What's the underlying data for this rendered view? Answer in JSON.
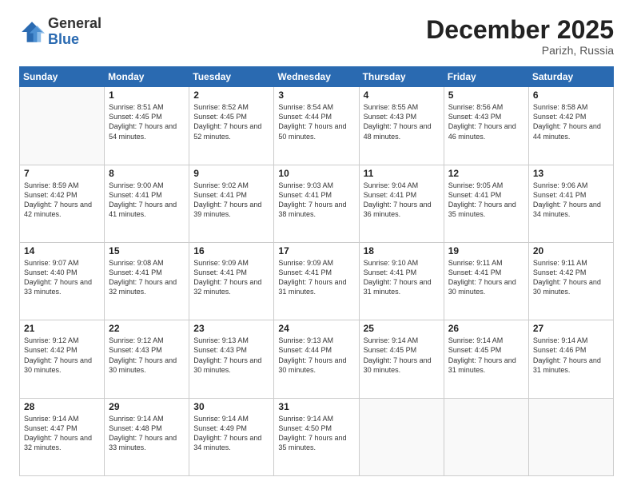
{
  "logo": {
    "general": "General",
    "blue": "Blue"
  },
  "header": {
    "month": "December 2025",
    "location": "Parizh, Russia"
  },
  "days_of_week": [
    "Sunday",
    "Monday",
    "Tuesday",
    "Wednesday",
    "Thursday",
    "Friday",
    "Saturday"
  ],
  "weeks": [
    [
      {
        "day": "",
        "sunrise": "",
        "sunset": "",
        "daylight": ""
      },
      {
        "day": "1",
        "sunrise": "Sunrise: 8:51 AM",
        "sunset": "Sunset: 4:45 PM",
        "daylight": "Daylight: 7 hours and 54 minutes."
      },
      {
        "day": "2",
        "sunrise": "Sunrise: 8:52 AM",
        "sunset": "Sunset: 4:45 PM",
        "daylight": "Daylight: 7 hours and 52 minutes."
      },
      {
        "day": "3",
        "sunrise": "Sunrise: 8:54 AM",
        "sunset": "Sunset: 4:44 PM",
        "daylight": "Daylight: 7 hours and 50 minutes."
      },
      {
        "day": "4",
        "sunrise": "Sunrise: 8:55 AM",
        "sunset": "Sunset: 4:43 PM",
        "daylight": "Daylight: 7 hours and 48 minutes."
      },
      {
        "day": "5",
        "sunrise": "Sunrise: 8:56 AM",
        "sunset": "Sunset: 4:43 PM",
        "daylight": "Daylight: 7 hours and 46 minutes."
      },
      {
        "day": "6",
        "sunrise": "Sunrise: 8:58 AM",
        "sunset": "Sunset: 4:42 PM",
        "daylight": "Daylight: 7 hours and 44 minutes."
      }
    ],
    [
      {
        "day": "7",
        "sunrise": "Sunrise: 8:59 AM",
        "sunset": "Sunset: 4:42 PM",
        "daylight": "Daylight: 7 hours and 42 minutes."
      },
      {
        "day": "8",
        "sunrise": "Sunrise: 9:00 AM",
        "sunset": "Sunset: 4:41 PM",
        "daylight": "Daylight: 7 hours and 41 minutes."
      },
      {
        "day": "9",
        "sunrise": "Sunrise: 9:02 AM",
        "sunset": "Sunset: 4:41 PM",
        "daylight": "Daylight: 7 hours and 39 minutes."
      },
      {
        "day": "10",
        "sunrise": "Sunrise: 9:03 AM",
        "sunset": "Sunset: 4:41 PM",
        "daylight": "Daylight: 7 hours and 38 minutes."
      },
      {
        "day": "11",
        "sunrise": "Sunrise: 9:04 AM",
        "sunset": "Sunset: 4:41 PM",
        "daylight": "Daylight: 7 hours and 36 minutes."
      },
      {
        "day": "12",
        "sunrise": "Sunrise: 9:05 AM",
        "sunset": "Sunset: 4:41 PM",
        "daylight": "Daylight: 7 hours and 35 minutes."
      },
      {
        "day": "13",
        "sunrise": "Sunrise: 9:06 AM",
        "sunset": "Sunset: 4:41 PM",
        "daylight": "Daylight: 7 hours and 34 minutes."
      }
    ],
    [
      {
        "day": "14",
        "sunrise": "Sunrise: 9:07 AM",
        "sunset": "Sunset: 4:40 PM",
        "daylight": "Daylight: 7 hours and 33 minutes."
      },
      {
        "day": "15",
        "sunrise": "Sunrise: 9:08 AM",
        "sunset": "Sunset: 4:41 PM",
        "daylight": "Daylight: 7 hours and 32 minutes."
      },
      {
        "day": "16",
        "sunrise": "Sunrise: 9:09 AM",
        "sunset": "Sunset: 4:41 PM",
        "daylight": "Daylight: 7 hours and 32 minutes."
      },
      {
        "day": "17",
        "sunrise": "Sunrise: 9:09 AM",
        "sunset": "Sunset: 4:41 PM",
        "daylight": "Daylight: 7 hours and 31 minutes."
      },
      {
        "day": "18",
        "sunrise": "Sunrise: 9:10 AM",
        "sunset": "Sunset: 4:41 PM",
        "daylight": "Daylight: 7 hours and 31 minutes."
      },
      {
        "day": "19",
        "sunrise": "Sunrise: 9:11 AM",
        "sunset": "Sunset: 4:41 PM",
        "daylight": "Daylight: 7 hours and 30 minutes."
      },
      {
        "day": "20",
        "sunrise": "Sunrise: 9:11 AM",
        "sunset": "Sunset: 4:42 PM",
        "daylight": "Daylight: 7 hours and 30 minutes."
      }
    ],
    [
      {
        "day": "21",
        "sunrise": "Sunrise: 9:12 AM",
        "sunset": "Sunset: 4:42 PM",
        "daylight": "Daylight: 7 hours and 30 minutes."
      },
      {
        "day": "22",
        "sunrise": "Sunrise: 9:12 AM",
        "sunset": "Sunset: 4:43 PM",
        "daylight": "Daylight: 7 hours and 30 minutes."
      },
      {
        "day": "23",
        "sunrise": "Sunrise: 9:13 AM",
        "sunset": "Sunset: 4:43 PM",
        "daylight": "Daylight: 7 hours and 30 minutes."
      },
      {
        "day": "24",
        "sunrise": "Sunrise: 9:13 AM",
        "sunset": "Sunset: 4:44 PM",
        "daylight": "Daylight: 7 hours and 30 minutes."
      },
      {
        "day": "25",
        "sunrise": "Sunrise: 9:14 AM",
        "sunset": "Sunset: 4:45 PM",
        "daylight": "Daylight: 7 hours and 30 minutes."
      },
      {
        "day": "26",
        "sunrise": "Sunrise: 9:14 AM",
        "sunset": "Sunset: 4:45 PM",
        "daylight": "Daylight: 7 hours and 31 minutes."
      },
      {
        "day": "27",
        "sunrise": "Sunrise: 9:14 AM",
        "sunset": "Sunset: 4:46 PM",
        "daylight": "Daylight: 7 hours and 31 minutes."
      }
    ],
    [
      {
        "day": "28",
        "sunrise": "Sunrise: 9:14 AM",
        "sunset": "Sunset: 4:47 PM",
        "daylight": "Daylight: 7 hours and 32 minutes."
      },
      {
        "day": "29",
        "sunrise": "Sunrise: 9:14 AM",
        "sunset": "Sunset: 4:48 PM",
        "daylight": "Daylight: 7 hours and 33 minutes."
      },
      {
        "day": "30",
        "sunrise": "Sunrise: 9:14 AM",
        "sunset": "Sunset: 4:49 PM",
        "daylight": "Daylight: 7 hours and 34 minutes."
      },
      {
        "day": "31",
        "sunrise": "Sunrise: 9:14 AM",
        "sunset": "Sunset: 4:50 PM",
        "daylight": "Daylight: 7 hours and 35 minutes."
      },
      {
        "day": "",
        "sunrise": "",
        "sunset": "",
        "daylight": ""
      },
      {
        "day": "",
        "sunrise": "",
        "sunset": "",
        "daylight": ""
      },
      {
        "day": "",
        "sunrise": "",
        "sunset": "",
        "daylight": ""
      }
    ]
  ]
}
